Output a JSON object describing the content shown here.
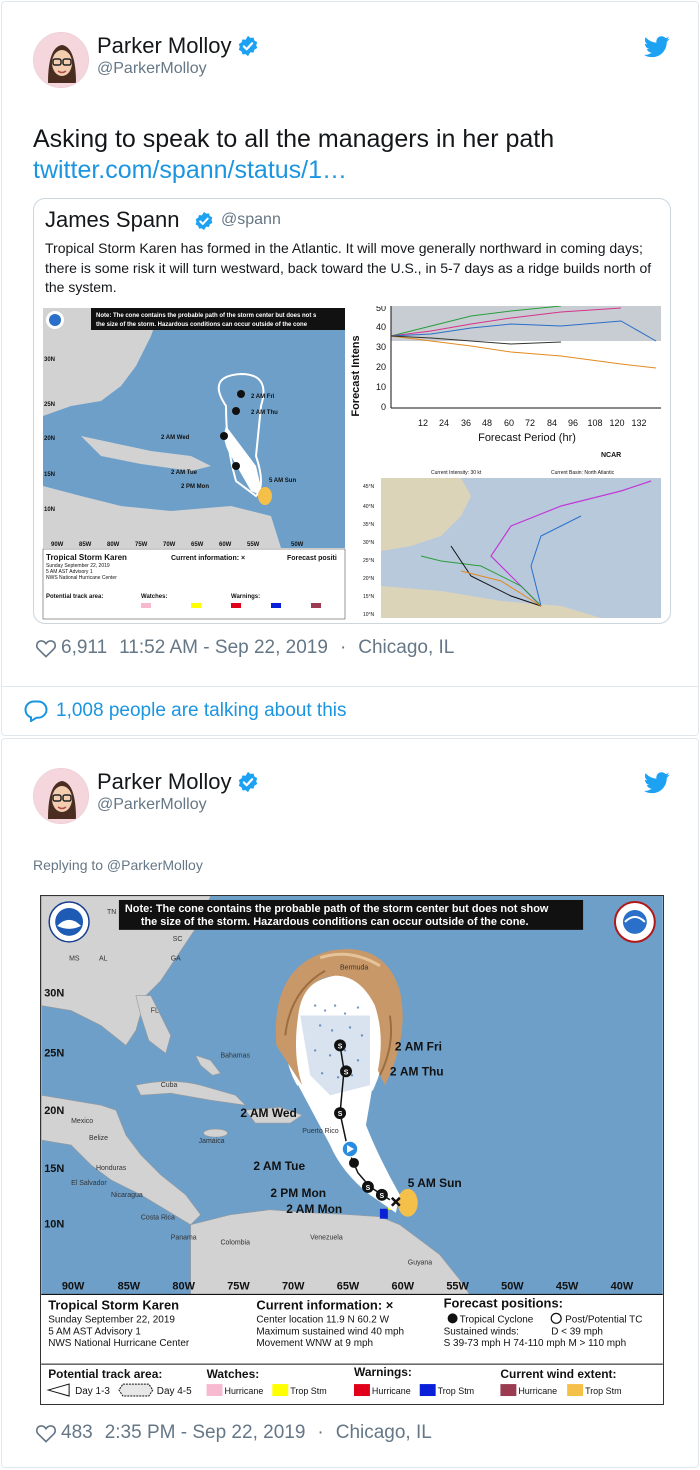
{
  "tweet1": {
    "author": {
      "name": "Parker Molloy",
      "handle": "@ParkerMolloy",
      "verified": true
    },
    "text": "Asking to speak to all the managers in her path",
    "link": "twitter.com/spann/status/1…",
    "quote": {
      "author": {
        "name": "James Spann",
        "handle": "@spann",
        "verified": true
      },
      "text": "Tropical Storm Karen has formed in the Atlantic. It will move generally northward in coming days; there is some risk it will turn westward, back toward the U.S., in 5-7 days as a ridge builds north of the system.",
      "map_note": "Note: The cone contains the probable path of the storm center but does not show the size of the storm. Hazardous conditions can occur outside of the cone.",
      "map_storm_title": "Tropical Storm Karen",
      "plot_xlabel": "Forecast Period (hr)",
      "plot_ylabel": "Forecast Intens",
      "plot_xticks": [
        "12",
        "24",
        "36",
        "48",
        "60",
        "72",
        "84",
        "96",
        "108",
        "120",
        "132"
      ],
      "plot_yticks": [
        "50",
        "40",
        "30",
        "20",
        "10",
        "0"
      ],
      "ensemble_intensity": "Current Intensity: 30 kt",
      "ensemble_basin": "Current Basin: North Atlantic"
    },
    "likes": "6,911",
    "timestamp": "11:52 AM - Sep 22, 2019",
    "location": "Chicago, IL",
    "talking": "1,008 people are talking about this"
  },
  "tweet2": {
    "author": {
      "name": "Parker Molloy",
      "handle": "@ParkerMolloy",
      "verified": true
    },
    "replying_to": "Replying to @ParkerMolloy",
    "map": {
      "note_line1": "Note: The cone contains the probable path of the storm center but does not show",
      "note_line2": "the size of the storm. Hazardous conditions can occur outside of the cone.",
      "lat_labels": [
        "30N",
        "25N",
        "20N",
        "15N",
        "10N"
      ],
      "lon_labels": [
        "90W",
        "85W",
        "80W",
        "75W",
        "70W",
        "65W",
        "60W",
        "55W",
        "50W",
        "45W",
        "40W"
      ],
      "places": [
        "Bermuda",
        "Bahamas",
        "Cuba",
        "Mexico",
        "Jamaica",
        "Honduras",
        "Nicaragua",
        "Colombia",
        "Venezuela",
        "Guyana",
        "Costa Rica",
        "Panama",
        "Belize",
        "El Salvador",
        "Puerto Rico",
        "FL",
        "GA",
        "MS",
        "AL",
        "SC",
        "TN"
      ],
      "track_labels": [
        "AM Fri",
        "AM Thu",
        "2 AM Wed",
        "2 AM Tue",
        "2 PM Mon",
        "2 AM Mon",
        "5 AM Sun"
      ],
      "storm_title": "Tropical Storm Karen",
      "storm_lines": [
        "Sunday September 22, 2019",
        "5 AM AST Advisory 1",
        "NWS National Hurricane Center"
      ],
      "current_info_title": "Current information: ×",
      "current_info_lines": [
        "Center location 11.9 N 60.2 W",
        "Maximum sustained wind 40 mph",
        "Movement WNW at 9 mph"
      ],
      "forecast_title": "Forecast positions:",
      "forecast_tc": "Tropical Cyclone",
      "forecast_post": "Post/Potential TC",
      "forecast_sustained": "Sustained winds:",
      "forecast_d": "D < 39 mph",
      "forecast_s": "S 39-73 mph  H 74-110 mph  M > 110 mph",
      "track_area_title": "Potential track area:",
      "track_day13": "Day 1-3",
      "track_day45": "Day 4-5",
      "watches_title": "Watches:",
      "warnings_title": "Warnings:",
      "wind_extent_title": "Current wind extent:",
      "hurricane": "Hurricane",
      "trop_stm": "Trop Stm",
      "colors": {
        "ocean": "#6d9fc9",
        "land": "#d2d2d2",
        "hurricane_watch": "#f7b9cf",
        "trop_watch": "#ffff00",
        "hurricane_warning": "#e0001a",
        "trop_warning": "#0a20d8",
        "hurricane_wind": "#9b3b51",
        "trop_wind": "#f5c04a"
      }
    },
    "likes": "483",
    "timestamp": "2:35 PM - Sep 22, 2019",
    "location": "Chicago, IL"
  }
}
